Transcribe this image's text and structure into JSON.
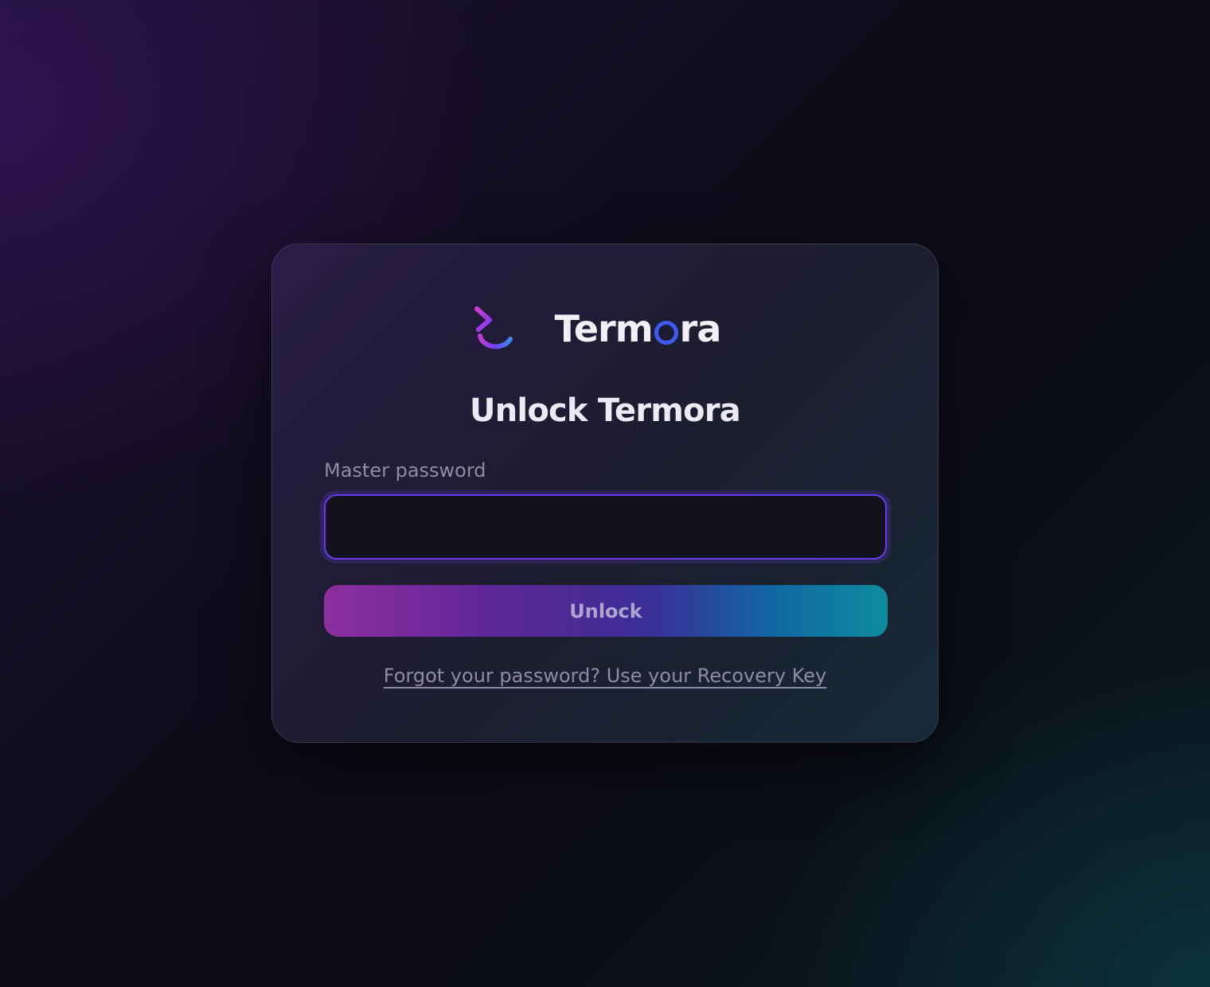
{
  "app": {
    "brand_name_before": "Term",
    "brand_name_after": "ra",
    "logo_icon": "terminal-prompt-icon"
  },
  "unlock": {
    "title": "Unlock Termora",
    "password_label": "Master password",
    "password_value": "",
    "button_label": "Unlock",
    "recovery_link": "Forgot your password? Use your Recovery Key"
  },
  "colors": {
    "accent_purple": "#6a3be8",
    "accent_magenta": "#8d2f9f",
    "accent_teal": "#0e8c9e",
    "brand_o_blue": "#3f5af4"
  }
}
